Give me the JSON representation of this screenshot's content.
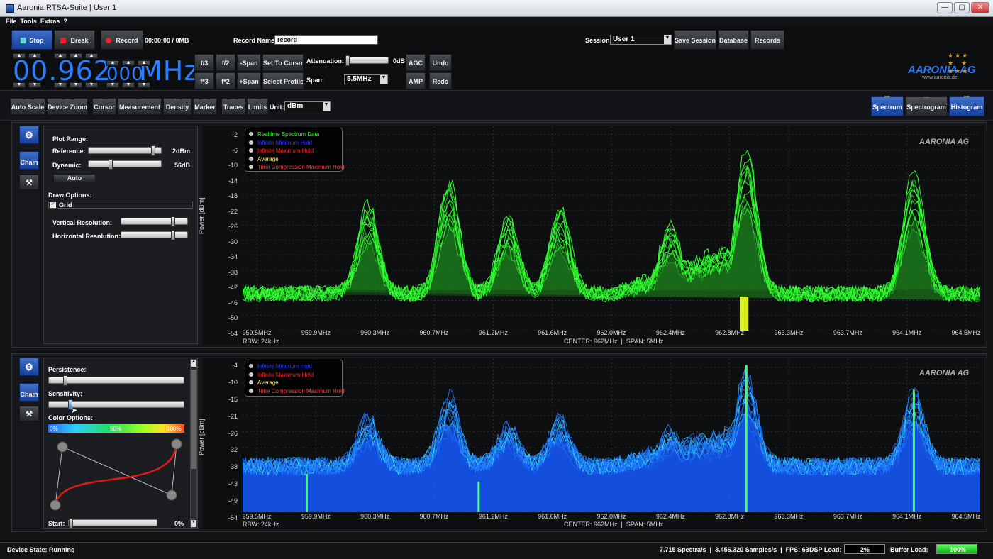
{
  "window": {
    "title": "Aaronia RTSA-Suite | User 1",
    "minimize": "—",
    "maximize": "▢",
    "close": "✕"
  },
  "menu": [
    "File",
    "Tools",
    "Extras",
    "?"
  ],
  "transport": {
    "stop": "Stop",
    "break": "Break",
    "record": "Record",
    "record_time": "00:00:00 / 0MB"
  },
  "record_name": {
    "label": "Record Name:",
    "value": "record"
  },
  "session": {
    "label": "Session:",
    "value": "User 1",
    "save": "Save Session",
    "database": "Database",
    "records": "Records"
  },
  "frequency": {
    "main": "00.962",
    "fine": "000",
    "unit": "MHz"
  },
  "freq_buttons": {
    "f_div3": "f/3",
    "f_div2": "f/2",
    "minus_span": "-Span",
    "set_to_cursor": "Set To Cursor",
    "f_mul3": "f*3",
    "f_mul2": "f*2",
    "plus_span": "+Span",
    "select_profile": "Select Profile"
  },
  "attenuation": {
    "label": "Attenuation:",
    "value": "0dB"
  },
  "span": {
    "label": "Span:",
    "value": "5.5MHz"
  },
  "agc": "AGC",
  "amp": "AMP",
  "undo": "Undo",
  "redo": "Redo",
  "logo": {
    "text": "AARONIA AG",
    "url": "www.aaronia.de"
  },
  "toolbar": {
    "auto_scale": "Auto Scale",
    "device_zoom": "Device Zoom",
    "cursor": "Cursor",
    "measurement": "Measurement",
    "density": "Density",
    "marker": "Marker",
    "traces": "Traces",
    "limits": "Limits",
    "unit_label": "Unit:",
    "unit_value": "dBm"
  },
  "views": {
    "spectrum": "Spectrum",
    "spectrogram": "Spectrogram",
    "histogram": "Histogram"
  },
  "side": {
    "chain": "Chain"
  },
  "plot_settings": {
    "plot_range": "Plot Range:",
    "reference": {
      "label": "Reference:",
      "value": "2dBm",
      "level": 0.9
    },
    "dynamic": {
      "label": "Dynamic:",
      "value": "56dB",
      "level": 0.3
    },
    "auto": "Auto",
    "draw_options": "Draw Options:",
    "grid": {
      "label": "Grid",
      "checked": "✓"
    },
    "vertical_resolution": {
      "label": "Vertical Resolution:",
      "level": 0.75
    },
    "horizontal_resolution": {
      "label": "Horizontal Resolution:",
      "level": 0.75
    }
  },
  "histogram_settings": {
    "persistence": {
      "label": "Persistence:",
      "level": 0.12
    },
    "sensitivity": {
      "label": "Sensitivity:",
      "level": 0.15
    },
    "color_options": "Color Options:",
    "grad_labels": [
      "0%",
      "50%",
      "100%"
    ],
    "start": {
      "label": "Start:",
      "value": "0%"
    }
  },
  "spectrum": {
    "ylabel": "Power [dBm]",
    "yticks": [
      "-2",
      "-6",
      "-10",
      "-14",
      "-18",
      "-22",
      "-26",
      "-30",
      "-34",
      "-38",
      "-42",
      "-46",
      "-50",
      "-54"
    ],
    "xticks": [
      "959.5MHz",
      "959.9MHz",
      "960.3MHz",
      "960.7MHz",
      "961.2MHz",
      "961.6MHz",
      "962.0MHz",
      "962.4MHz",
      "962.8MHz",
      "963.3MHz",
      "963.7MHz",
      "964.1MHz",
      "964.5MHz"
    ],
    "rbw": "RBW: 24kHz",
    "center_span": "CENTER: 962MHz  |  SPAN: 5MHz",
    "legend": [
      {
        "label": "Realtime Spectrum Data",
        "color": "#33ff33"
      },
      {
        "label": "Infinite Minimum Hold",
        "color": "#2a3cff"
      },
      {
        "label": "Infinite Maximum Hold",
        "color": "#ff2020"
      },
      {
        "label": "Average",
        "color": "#ffff66"
      },
      {
        "label": "Time Compression Maximum Hold",
        "color": "#ff4040"
      }
    ]
  },
  "histogram": {
    "ylabel": "Power [dBm]",
    "yticks": [
      "-4",
      "-10",
      "-15",
      "-21",
      "-26",
      "-32",
      "-38",
      "-43",
      "-49",
      "-54"
    ],
    "xticks": [
      "959.5MHz",
      "959.9MHz",
      "960.3MHz",
      "960.7MHz",
      "961.2MHz",
      "961.6MHz",
      "962.0MHz",
      "962.4MHz",
      "962.8MHz",
      "963.3MHz",
      "963.7MHz",
      "964.1MHz",
      "964.5MHz"
    ],
    "rbw": "RBW: 24kHz",
    "center_span": "CENTER: 962MHz  |  SPAN: 5MHz",
    "legend": [
      {
        "label": "Infinite Minimum Hold",
        "color": "#2a3cff"
      },
      {
        "label": "Infinite Maximum Hold",
        "color": "#ff2020"
      },
      {
        "label": "Average",
        "color": "#ffff66"
      },
      {
        "label": "Time Compression Maximum Hold",
        "color": "#ff4040"
      }
    ]
  },
  "status": {
    "device_state": "Device State: Running",
    "rates": "7.715 Spectra/s  |  3.456.320 Samples/s  |  FPS: 63",
    "dsp_label": "DSP Load:",
    "dsp_value": "2%",
    "dsp_level": 0.02,
    "buffer_label": "Buffer Load:",
    "buffer_value": "100%",
    "buffer_level": 1.0
  },
  "colors": {
    "spectrum": "#33ff33",
    "histogram": "#1f7bff",
    "accent": "#2c7dff"
  }
}
